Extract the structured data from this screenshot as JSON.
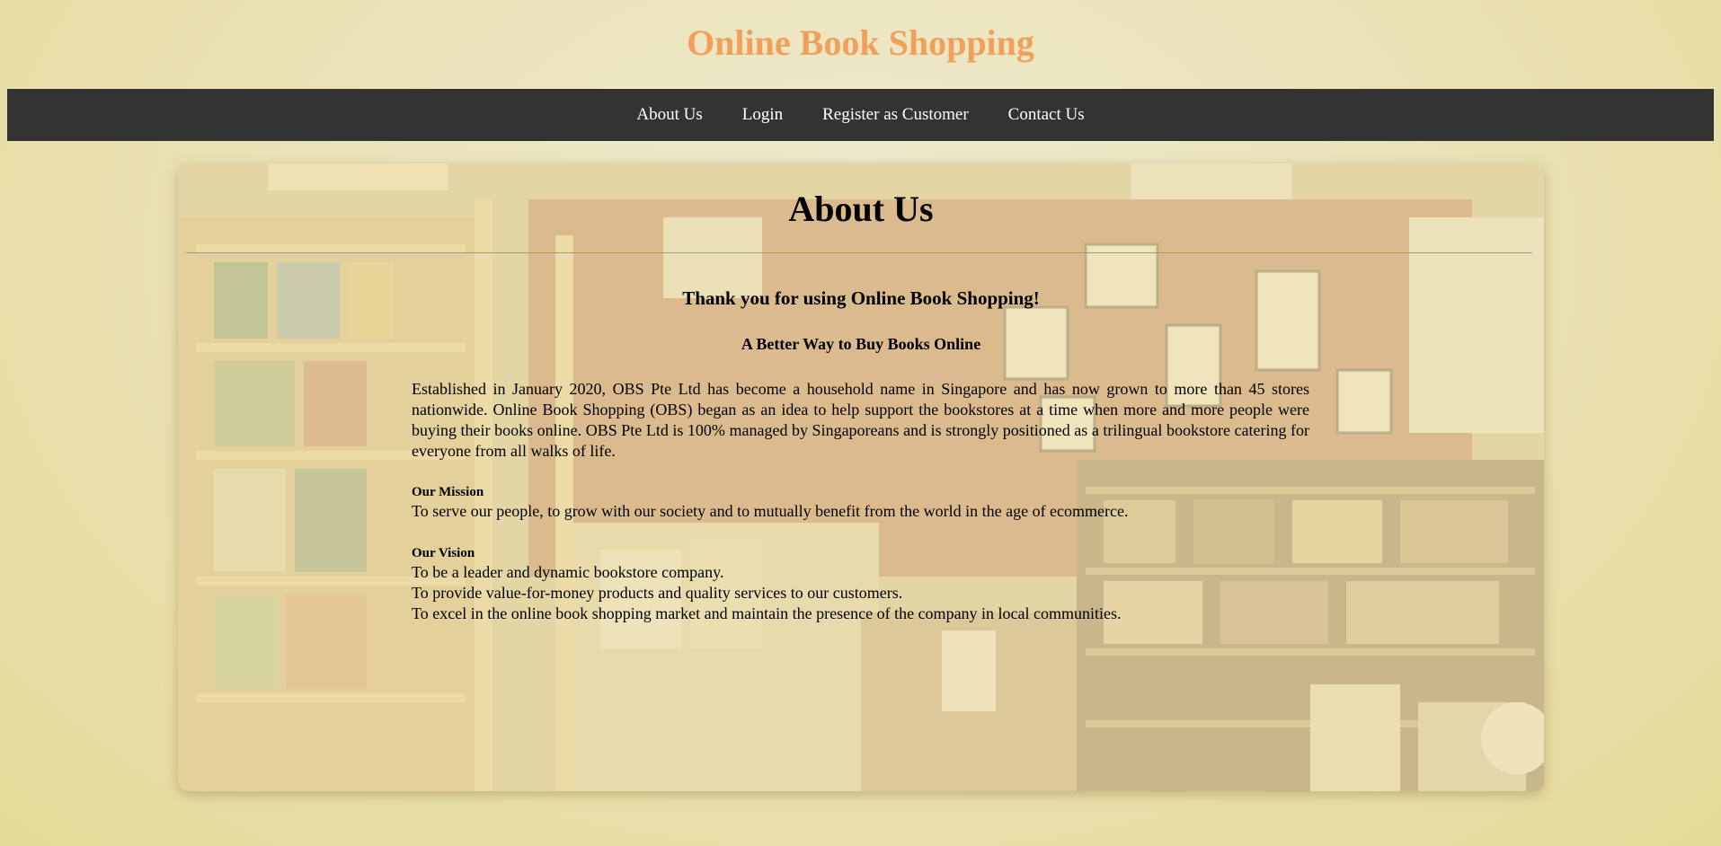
{
  "site": {
    "title": "Online Book Shopping"
  },
  "nav": {
    "items": [
      {
        "label": "About Us"
      },
      {
        "label": "Login"
      },
      {
        "label": "Register as Customer"
      },
      {
        "label": "Contact Us"
      }
    ]
  },
  "main": {
    "heading": "About Us",
    "thanks": "Thank you for using Online Book Shopping!",
    "tagline": "A Better Way to Buy Books Online",
    "intro": "Established in January 2020, OBS Pte Ltd has become a household name in Singapore and has now grown to more than 45 stores nationwide. Online Book Shopping (OBS) began as an idea to help support the bookstores at a time when more and more people were buying their books online. OBS Pte Ltd is 100% managed by Singaporeans and is strongly positioned as a trilingual bookstore catering for everyone from all walks of life.",
    "mission": {
      "label": "Our Mission",
      "text": "To serve our people, to grow with our society and to mutually benefit from the world in the age of ecommerce."
    },
    "vision": {
      "label": "Our Vision",
      "lines": [
        "To be a leader and dynamic bookstore company.",
        "To provide value-for-money products and quality services to our customers.",
        "To excel in the online book shopping market and maintain the presence of the company in local communities."
      ]
    }
  },
  "colors": {
    "title": "#f0a05a",
    "navbar": "#333333",
    "nav_text": "#ffffff",
    "page_background": "#ebe3b9"
  }
}
